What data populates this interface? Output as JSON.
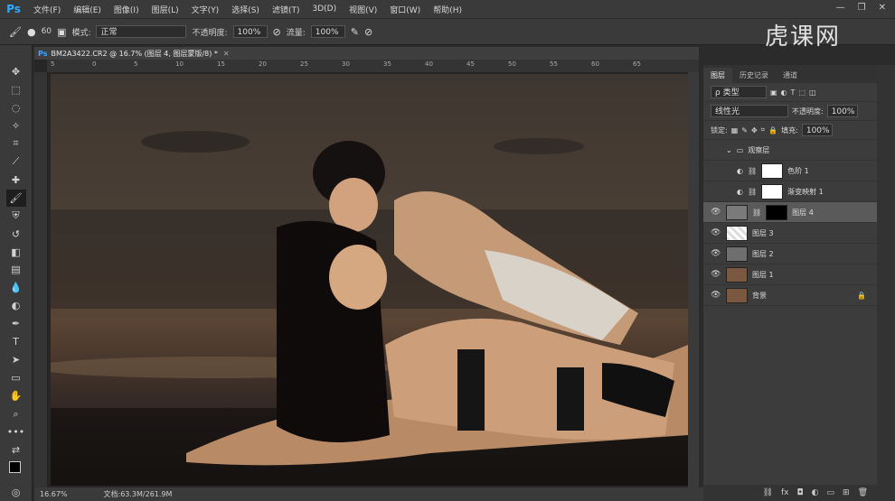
{
  "menubar": {
    "logo": "Ps",
    "items": [
      "文件(F)",
      "编辑(E)",
      "图像(I)",
      "图层(L)",
      "文字(Y)",
      "选择(S)",
      "滤镜(T)",
      "3D(D)",
      "视图(V)",
      "窗口(W)",
      "帮助(H)"
    ]
  },
  "options": {
    "brush_size": "60",
    "mode_label": "模式:",
    "mode_value": "正常",
    "opacity_label": "不透明度:",
    "opacity_value": "100%",
    "flow_label": "流量:",
    "flow_value": "100%"
  },
  "watermark": "虎课网",
  "document": {
    "tab_title": "BM2A3422.CR2 @ 16.7% (图层 4, 图层蒙版/8) *",
    "ruler_marks": [
      "5",
      "0",
      "5",
      "10",
      "15",
      "20",
      "25",
      "30",
      "35",
      "40",
      "45",
      "50",
      "55",
      "60",
      "65"
    ],
    "zoom": "16.67%",
    "doc_info": "文档:63.3M/261.9M"
  },
  "layers_panel": {
    "tabs": [
      "图层",
      "历史记录",
      "通道"
    ],
    "filter_label": "ρ 类型",
    "blend_mode": "线性光",
    "opacity_label": "不透明度:",
    "opacity_value": "100%",
    "lock_label": "锁定:",
    "fill_label": "填充:",
    "fill_value": "100%",
    "layers": [
      {
        "name": "观察层"
      },
      {
        "name": "色阶 1"
      },
      {
        "name": "渐变映射 1"
      },
      {
        "name": "图层 4"
      },
      {
        "name": "图层 3"
      },
      {
        "name": "图层 2"
      },
      {
        "name": "图层 1"
      },
      {
        "name": "背景"
      }
    ]
  },
  "colors": {
    "accent": "#31a8ff",
    "panel_bg": "#3c3c3c",
    "selected_layer": "#5a5a5a"
  }
}
